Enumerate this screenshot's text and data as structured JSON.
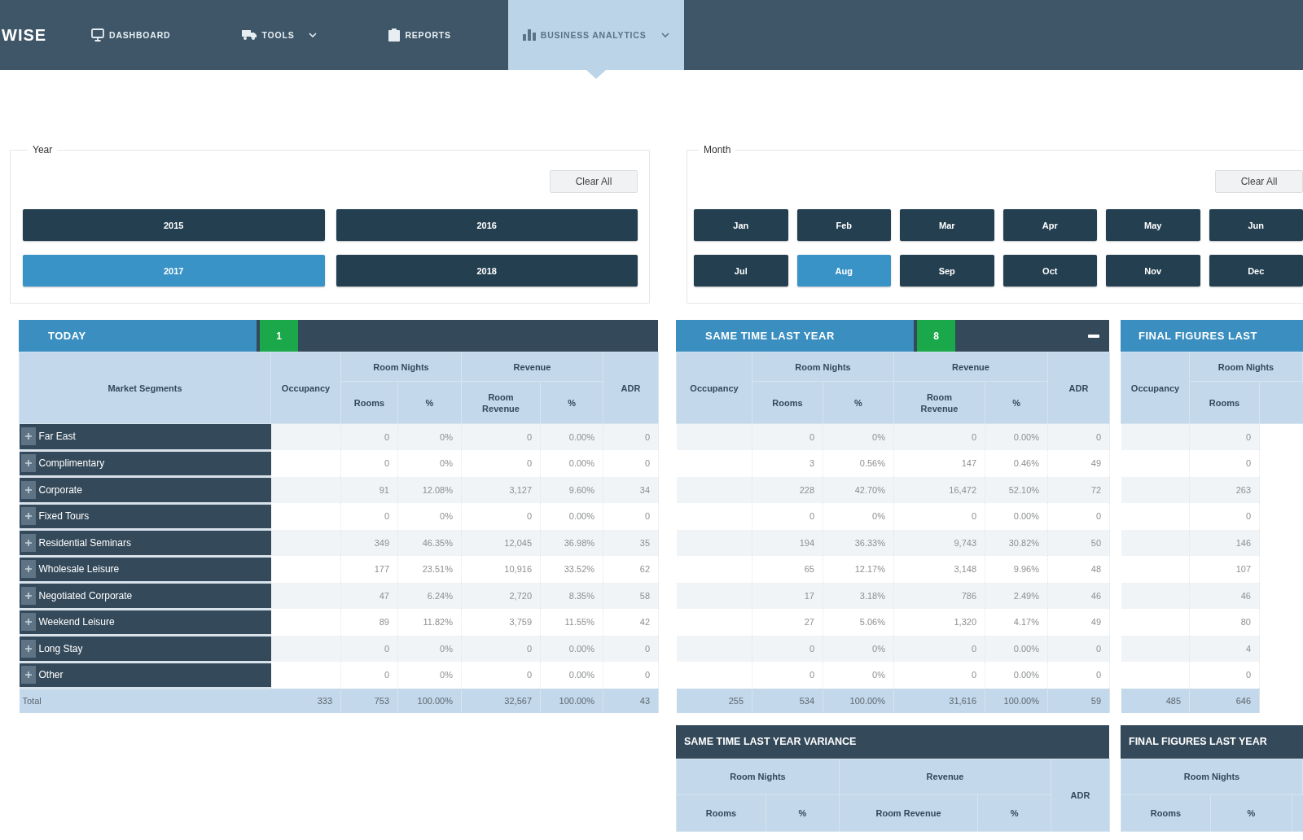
{
  "nav": {
    "logo": "WISE",
    "items": [
      {
        "label": "DASHBOARD",
        "selected": false,
        "dropdown": false
      },
      {
        "label": "TOOLS",
        "selected": false,
        "dropdown": true
      },
      {
        "label": "REPORTS",
        "selected": false,
        "dropdown": false
      },
      {
        "label": "BUSINESS ANALYTICS",
        "selected": true,
        "dropdown": true
      }
    ]
  },
  "filters": [
    {
      "legend": "Year",
      "clear_button": "Clear All",
      "options": [
        {
          "label": "2015",
          "selected": false
        },
        {
          "label": "2016",
          "selected": false
        },
        {
          "label": "2017",
          "selected": true
        },
        {
          "label": "2018",
          "selected": false
        }
      ]
    },
    {
      "legend": "Month",
      "clear_button": "Clear All",
      "options": [
        {
          "label": "Jan",
          "selected": false
        },
        {
          "label": "Feb",
          "selected": false
        },
        {
          "label": "Mar",
          "selected": false
        },
        {
          "label": "Apr",
          "selected": false
        },
        {
          "label": "May",
          "selected": false
        },
        {
          "label": "Jun",
          "selected": false
        },
        {
          "label": "Jul",
          "selected": false
        },
        {
          "label": "Aug",
          "selected": true
        },
        {
          "label": "Sep",
          "selected": false
        },
        {
          "label": "Oct",
          "selected": false
        },
        {
          "label": "Nov",
          "selected": false
        },
        {
          "label": "Dec",
          "selected": false
        }
      ]
    }
  ],
  "panels": [
    {
      "kind": "figures",
      "title": "TODAY",
      "badge": "1",
      "collapsible": false,
      "headers": {
        "segment": "Market Segments",
        "occupancy": "Occupancy",
        "room_nights": "Room Nights",
        "rooms": "Rooms",
        "rooms_pct": "%",
        "revenue": "Revenue",
        "room_revenue": "Room Revenue",
        "revenue_pct": "%",
        "adr": "ADR"
      },
      "rows": [
        {
          "segment": "Far East",
          "rooms": "0",
          "rooms_pct": "0%",
          "room_revenue": "0",
          "revenue_pct": "0.00%",
          "adr": "0"
        },
        {
          "segment": "Complimentary",
          "rooms": "0",
          "rooms_pct": "0%",
          "room_revenue": "0",
          "revenue_pct": "0.00%",
          "adr": "0"
        },
        {
          "segment": "Corporate",
          "rooms": "91",
          "rooms_pct": "12.08%",
          "room_revenue": "3,127",
          "revenue_pct": "9.60%",
          "adr": "34"
        },
        {
          "segment": "Fixed Tours",
          "rooms": "0",
          "rooms_pct": "0%",
          "room_revenue": "0",
          "revenue_pct": "0.00%",
          "adr": "0"
        },
        {
          "segment": "Residential Seminars",
          "rooms": "349",
          "rooms_pct": "46.35%",
          "room_revenue": "12,045",
          "revenue_pct": "36.98%",
          "adr": "35"
        },
        {
          "segment": "Wholesale Leisure",
          "rooms": "177",
          "rooms_pct": "23.51%",
          "room_revenue": "10,916",
          "revenue_pct": "33.52%",
          "adr": "62"
        },
        {
          "segment": "Negotiated Corporate",
          "rooms": "47",
          "rooms_pct": "6.24%",
          "room_revenue": "2,720",
          "revenue_pct": "8.35%",
          "adr": "58"
        },
        {
          "segment": "Weekend Leisure",
          "rooms": "89",
          "rooms_pct": "11.82%",
          "room_revenue": "3,759",
          "revenue_pct": "11.55%",
          "adr": "42"
        },
        {
          "segment": "Long Stay",
          "rooms": "0",
          "rooms_pct": "0%",
          "room_revenue": "0",
          "revenue_pct": "0.00%",
          "adr": "0"
        },
        {
          "segment": "Other",
          "rooms": "0",
          "rooms_pct": "0%",
          "room_revenue": "0",
          "revenue_pct": "0.00%",
          "adr": "0"
        }
      ],
      "total": {
        "label": "Total",
        "occupancy": "333",
        "rooms": "753",
        "rooms_pct": "100.00%",
        "room_revenue": "32,567",
        "revenue_pct": "100.00%",
        "adr": "43"
      }
    },
    {
      "kind": "figures",
      "title": "SAME TIME LAST YEAR",
      "badge": "8",
      "collapsible": true,
      "headers": {
        "occupancy": "Occupancy",
        "room_nights": "Room Nights",
        "rooms": "Rooms",
        "rooms_pct": "%",
        "revenue": "Revenue",
        "room_revenue": "Room Revenue",
        "revenue_pct": "%",
        "adr": "ADR"
      },
      "rows": [
        {
          "rooms": "0",
          "rooms_pct": "0%",
          "room_revenue": "0",
          "revenue_pct": "0.00%",
          "adr": "0"
        },
        {
          "rooms": "3",
          "rooms_pct": "0.56%",
          "room_revenue": "147",
          "revenue_pct": "0.46%",
          "adr": "49"
        },
        {
          "rooms": "228",
          "rooms_pct": "42.70%",
          "room_revenue": "16,472",
          "revenue_pct": "52.10%",
          "adr": "72"
        },
        {
          "rooms": "0",
          "rooms_pct": "0%",
          "room_revenue": "0",
          "revenue_pct": "0.00%",
          "adr": "0"
        },
        {
          "rooms": "194",
          "rooms_pct": "36.33%",
          "room_revenue": "9,743",
          "revenue_pct": "30.82%",
          "adr": "50"
        },
        {
          "rooms": "65",
          "rooms_pct": "12.17%",
          "room_revenue": "3,148",
          "revenue_pct": "9.96%",
          "adr": "48"
        },
        {
          "rooms": "17",
          "rooms_pct": "3.18%",
          "room_revenue": "786",
          "revenue_pct": "2.49%",
          "adr": "46"
        },
        {
          "rooms": "27",
          "rooms_pct": "5.06%",
          "room_revenue": "1,320",
          "revenue_pct": "4.17%",
          "adr": "49"
        },
        {
          "rooms": "0",
          "rooms_pct": "0%",
          "room_revenue": "0",
          "revenue_pct": "0.00%",
          "adr": "0"
        },
        {
          "rooms": "0",
          "rooms_pct": "0%",
          "room_revenue": "0",
          "revenue_pct": "0.00%",
          "adr": "0"
        }
      ],
      "total": {
        "occupancy": "255",
        "rooms": "534",
        "rooms_pct": "100.00%",
        "room_revenue": "31,616",
        "revenue_pct": "100.00%",
        "adr": "59"
      }
    },
    {
      "kind": "figures",
      "title": "FINAL FIGURES LAST",
      "collapsible": false,
      "headers": {
        "occupancy": "Occupancy",
        "room_nights": "Room Nights",
        "rooms": "Rooms"
      },
      "rows": [
        {
          "rooms": "0"
        },
        {
          "rooms": "0"
        },
        {
          "rooms": "263"
        },
        {
          "rooms": "0"
        },
        {
          "rooms": "146"
        },
        {
          "rooms": "107"
        },
        {
          "rooms": "46"
        },
        {
          "rooms": "80"
        },
        {
          "rooms": "4"
        },
        {
          "rooms": "0"
        }
      ],
      "total": {
        "occupancy": "485",
        "rooms": "646"
      }
    },
    {
      "kind": "variance",
      "title": "SAME TIME LAST YEAR VARIANCE",
      "collapsible": false,
      "headers": {
        "room_nights": "Room Nights",
        "rooms": "Rooms",
        "rooms_pct": "%",
        "revenue": "Revenue",
        "room_revenue": "Room Revenue",
        "revenue_pct": "%",
        "adr": "ADR"
      }
    },
    {
      "kind": "variance",
      "title": "FINAL FIGURES LAST YEAR",
      "collapsible": false,
      "headers": {
        "room_nights": "Room Nights",
        "rooms": "Rooms",
        "rooms_pct": "%"
      }
    }
  ]
}
